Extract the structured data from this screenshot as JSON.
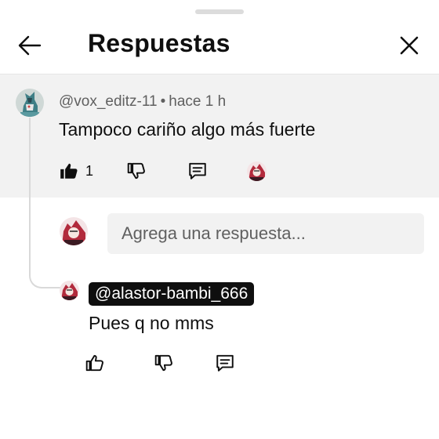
{
  "sheet": {
    "drag_handle": "drag-handle"
  },
  "header": {
    "title": "Respuestas",
    "back_icon": "arrow-left-icon",
    "close_icon": "close-icon"
  },
  "parent_comment": {
    "author": "@vox_editz-11",
    "separator": "•",
    "time": "hace 1 h",
    "text": "Tampoco cariño algo más fuerte",
    "likes": "1",
    "avatar": "user-avatar"
  },
  "reply_box": {
    "placeholder": "Agrega una respuesta..."
  },
  "reply": {
    "mention": "@alastor-bambi_666",
    "text": "Pues q no mms"
  },
  "colors": {
    "background": "#ffffff",
    "highlight": "#f2f2f2",
    "text": "#0f0f0f",
    "secondary_text": "#606060",
    "mention_bg": "#0f0f0f"
  }
}
